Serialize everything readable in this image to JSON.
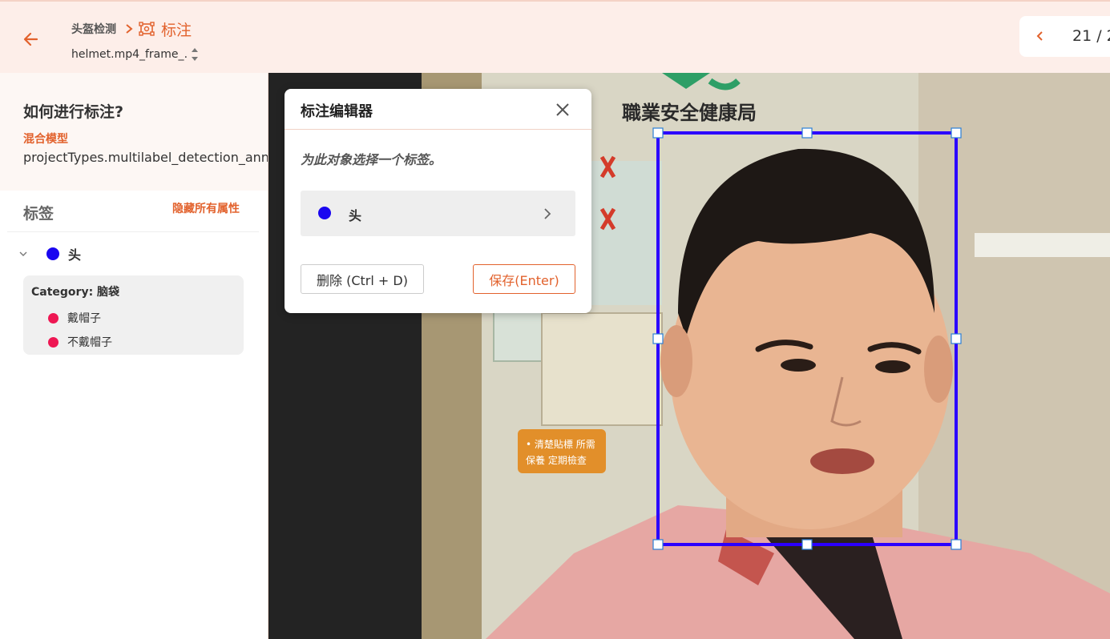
{
  "header": {
    "project_name": "头盔检测",
    "task_label": "标注",
    "file_name": "helmet.mp4_frame_…",
    "pager_text": "21 / 2"
  },
  "sidebar": {
    "howto_title": "如何进行标注?",
    "model_type": "混合模型",
    "model_key": "projectTypes.multilabel_detection_annotation",
    "labels_title": "标签",
    "hide_attrs": "隐藏所有属性",
    "label": {
      "name": "头",
      "color": "#1a06f0"
    },
    "category": {
      "title": "Category: 脑袋",
      "options": [
        "戴帽子",
        "不戴帽子"
      ],
      "option_color": "#ee1753"
    }
  },
  "canvas": {
    "poster_text": "職業安全健康局",
    "sign_lines": [
      "• 清楚貼標 所需",
      "保養 定期檢查"
    ],
    "bbox_color": "#2b00ff"
  },
  "modal": {
    "title": "标注编辑器",
    "prompt": "为此对象选择一个标签。",
    "label_name": "头",
    "delete_label": "删除 (Ctrl + D)",
    "save_label": "保存(Enter)"
  },
  "colors": {
    "accent": "#e2622d",
    "header_bg": "#fdeee9"
  }
}
